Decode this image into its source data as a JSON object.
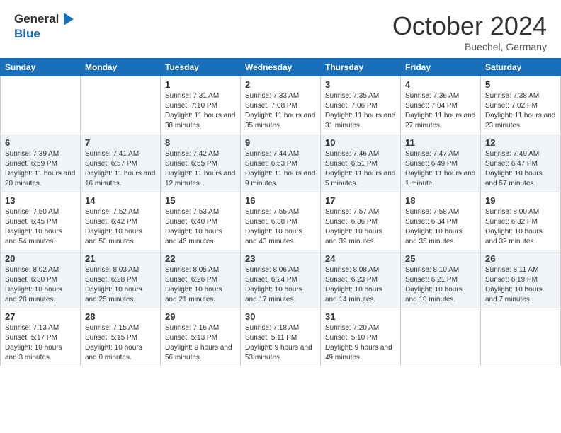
{
  "header": {
    "logo": {
      "line1": "General",
      "line2": "Blue"
    },
    "month": "October 2024",
    "location": "Buechel, Germany"
  },
  "weekdays": [
    "Sunday",
    "Monday",
    "Tuesday",
    "Wednesday",
    "Thursday",
    "Friday",
    "Saturday"
  ],
  "weeks": [
    [
      {
        "day": "",
        "sunrise": "",
        "sunset": "",
        "daylight": ""
      },
      {
        "day": "",
        "sunrise": "",
        "sunset": "",
        "daylight": ""
      },
      {
        "day": "1",
        "sunrise": "Sunrise: 7:31 AM",
        "sunset": "Sunset: 7:10 PM",
        "daylight": "Daylight: 11 hours and 38 minutes."
      },
      {
        "day": "2",
        "sunrise": "Sunrise: 7:33 AM",
        "sunset": "Sunset: 7:08 PM",
        "daylight": "Daylight: 11 hours and 35 minutes."
      },
      {
        "day": "3",
        "sunrise": "Sunrise: 7:35 AM",
        "sunset": "Sunset: 7:06 PM",
        "daylight": "Daylight: 11 hours and 31 minutes."
      },
      {
        "day": "4",
        "sunrise": "Sunrise: 7:36 AM",
        "sunset": "Sunset: 7:04 PM",
        "daylight": "Daylight: 11 hours and 27 minutes."
      },
      {
        "day": "5",
        "sunrise": "Sunrise: 7:38 AM",
        "sunset": "Sunset: 7:02 PM",
        "daylight": "Daylight: 11 hours and 23 minutes."
      }
    ],
    [
      {
        "day": "6",
        "sunrise": "Sunrise: 7:39 AM",
        "sunset": "Sunset: 6:59 PM",
        "daylight": "Daylight: 11 hours and 20 minutes."
      },
      {
        "day": "7",
        "sunrise": "Sunrise: 7:41 AM",
        "sunset": "Sunset: 6:57 PM",
        "daylight": "Daylight: 11 hours and 16 minutes."
      },
      {
        "day": "8",
        "sunrise": "Sunrise: 7:42 AM",
        "sunset": "Sunset: 6:55 PM",
        "daylight": "Daylight: 11 hours and 12 minutes."
      },
      {
        "day": "9",
        "sunrise": "Sunrise: 7:44 AM",
        "sunset": "Sunset: 6:53 PM",
        "daylight": "Daylight: 11 hours and 9 minutes."
      },
      {
        "day": "10",
        "sunrise": "Sunrise: 7:46 AM",
        "sunset": "Sunset: 6:51 PM",
        "daylight": "Daylight: 11 hours and 5 minutes."
      },
      {
        "day": "11",
        "sunrise": "Sunrise: 7:47 AM",
        "sunset": "Sunset: 6:49 PM",
        "daylight": "Daylight: 11 hours and 1 minute."
      },
      {
        "day": "12",
        "sunrise": "Sunrise: 7:49 AM",
        "sunset": "Sunset: 6:47 PM",
        "daylight": "Daylight: 10 hours and 57 minutes."
      }
    ],
    [
      {
        "day": "13",
        "sunrise": "Sunrise: 7:50 AM",
        "sunset": "Sunset: 6:45 PM",
        "daylight": "Daylight: 10 hours and 54 minutes."
      },
      {
        "day": "14",
        "sunrise": "Sunrise: 7:52 AM",
        "sunset": "Sunset: 6:42 PM",
        "daylight": "Daylight: 10 hours and 50 minutes."
      },
      {
        "day": "15",
        "sunrise": "Sunrise: 7:53 AM",
        "sunset": "Sunset: 6:40 PM",
        "daylight": "Daylight: 10 hours and 46 minutes."
      },
      {
        "day": "16",
        "sunrise": "Sunrise: 7:55 AM",
        "sunset": "Sunset: 6:38 PM",
        "daylight": "Daylight: 10 hours and 43 minutes."
      },
      {
        "day": "17",
        "sunrise": "Sunrise: 7:57 AM",
        "sunset": "Sunset: 6:36 PM",
        "daylight": "Daylight: 10 hours and 39 minutes."
      },
      {
        "day": "18",
        "sunrise": "Sunrise: 7:58 AM",
        "sunset": "Sunset: 6:34 PM",
        "daylight": "Daylight: 10 hours and 35 minutes."
      },
      {
        "day": "19",
        "sunrise": "Sunrise: 8:00 AM",
        "sunset": "Sunset: 6:32 PM",
        "daylight": "Daylight: 10 hours and 32 minutes."
      }
    ],
    [
      {
        "day": "20",
        "sunrise": "Sunrise: 8:02 AM",
        "sunset": "Sunset: 6:30 PM",
        "daylight": "Daylight: 10 hours and 28 minutes."
      },
      {
        "day": "21",
        "sunrise": "Sunrise: 8:03 AM",
        "sunset": "Sunset: 6:28 PM",
        "daylight": "Daylight: 10 hours and 25 minutes."
      },
      {
        "day": "22",
        "sunrise": "Sunrise: 8:05 AM",
        "sunset": "Sunset: 6:26 PM",
        "daylight": "Daylight: 10 hours and 21 minutes."
      },
      {
        "day": "23",
        "sunrise": "Sunrise: 8:06 AM",
        "sunset": "Sunset: 6:24 PM",
        "daylight": "Daylight: 10 hours and 17 minutes."
      },
      {
        "day": "24",
        "sunrise": "Sunrise: 8:08 AM",
        "sunset": "Sunset: 6:23 PM",
        "daylight": "Daylight: 10 hours and 14 minutes."
      },
      {
        "day": "25",
        "sunrise": "Sunrise: 8:10 AM",
        "sunset": "Sunset: 6:21 PM",
        "daylight": "Daylight: 10 hours and 10 minutes."
      },
      {
        "day": "26",
        "sunrise": "Sunrise: 8:11 AM",
        "sunset": "Sunset: 6:19 PM",
        "daylight": "Daylight: 10 hours and 7 minutes."
      }
    ],
    [
      {
        "day": "27",
        "sunrise": "Sunrise: 7:13 AM",
        "sunset": "Sunset: 5:17 PM",
        "daylight": "Daylight: 10 hours and 3 minutes."
      },
      {
        "day": "28",
        "sunrise": "Sunrise: 7:15 AM",
        "sunset": "Sunset: 5:15 PM",
        "daylight": "Daylight: 10 hours and 0 minutes."
      },
      {
        "day": "29",
        "sunrise": "Sunrise: 7:16 AM",
        "sunset": "Sunset: 5:13 PM",
        "daylight": "Daylight: 9 hours and 56 minutes."
      },
      {
        "day": "30",
        "sunrise": "Sunrise: 7:18 AM",
        "sunset": "Sunset: 5:11 PM",
        "daylight": "Daylight: 9 hours and 53 minutes."
      },
      {
        "day": "31",
        "sunrise": "Sunrise: 7:20 AM",
        "sunset": "Sunset: 5:10 PM",
        "daylight": "Daylight: 9 hours and 49 minutes."
      },
      {
        "day": "",
        "sunrise": "",
        "sunset": "",
        "daylight": ""
      },
      {
        "day": "",
        "sunrise": "",
        "sunset": "",
        "daylight": ""
      }
    ]
  ]
}
